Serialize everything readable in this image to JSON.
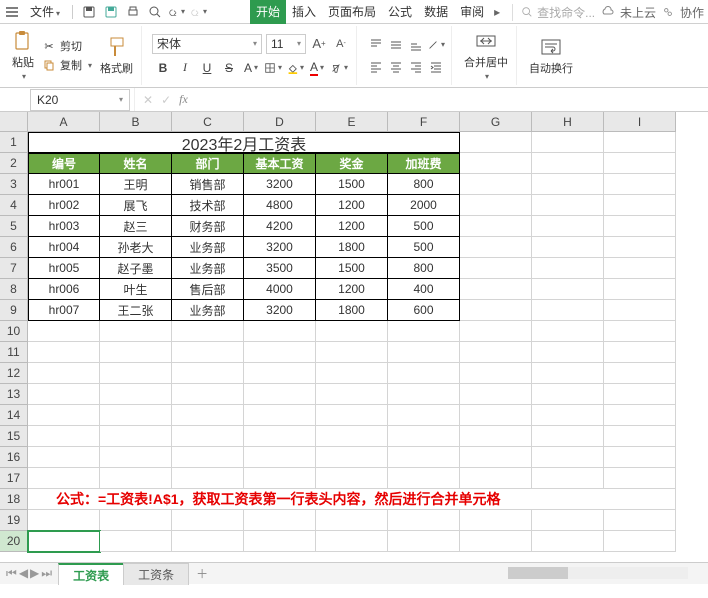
{
  "menubar": {
    "file_label": "文件",
    "search_placeholder": "查找命令...",
    "cloud_label": "未上云",
    "coop_label": "协作"
  },
  "ribbon_tabs": [
    "开始",
    "插入",
    "页面布局",
    "公式",
    "数据",
    "审阅"
  ],
  "active_tab_index": 0,
  "clipboard": {
    "paste": "粘贴",
    "cut": "剪切",
    "copy": "复制",
    "format_painter": "格式刷"
  },
  "font": {
    "name": "宋体",
    "size": "11"
  },
  "align": {
    "merge_center": "合并居中",
    "wrap": "自动换行"
  },
  "name_box": "K20",
  "columns": [
    "A",
    "B",
    "C",
    "D",
    "E",
    "F",
    "G",
    "H",
    "I"
  ],
  "row_count": 20,
  "selected_row": 20,
  "sheet": {
    "title": "2023年2月工资表",
    "headers": [
      "编号",
      "姓名",
      "部门",
      "基本工资",
      "奖金",
      "加班费"
    ],
    "rows": [
      [
        "hr001",
        "王明",
        "销售部",
        "3200",
        "1500",
        "800"
      ],
      [
        "hr002",
        "展飞",
        "技术部",
        "4800",
        "1200",
        "2000"
      ],
      [
        "hr003",
        "赵三",
        "财务部",
        "4200",
        "1200",
        "500"
      ],
      [
        "hr004",
        "孙老大",
        "业务部",
        "3200",
        "1800",
        "500"
      ],
      [
        "hr005",
        "赵子墨",
        "业务部",
        "3500",
        "1500",
        "800"
      ],
      [
        "hr006",
        "叶生",
        "售后部",
        "4000",
        "1200",
        "400"
      ],
      [
        "hr007",
        "王二张",
        "业务部",
        "3200",
        "1800",
        "600"
      ]
    ],
    "formula_note": "公式：=工资表!A$1，获取工资表第一行表头内容，然后进行合并单元格"
  },
  "sheet_tabs": [
    "工资表",
    "工资条"
  ],
  "active_sheet": 0
}
